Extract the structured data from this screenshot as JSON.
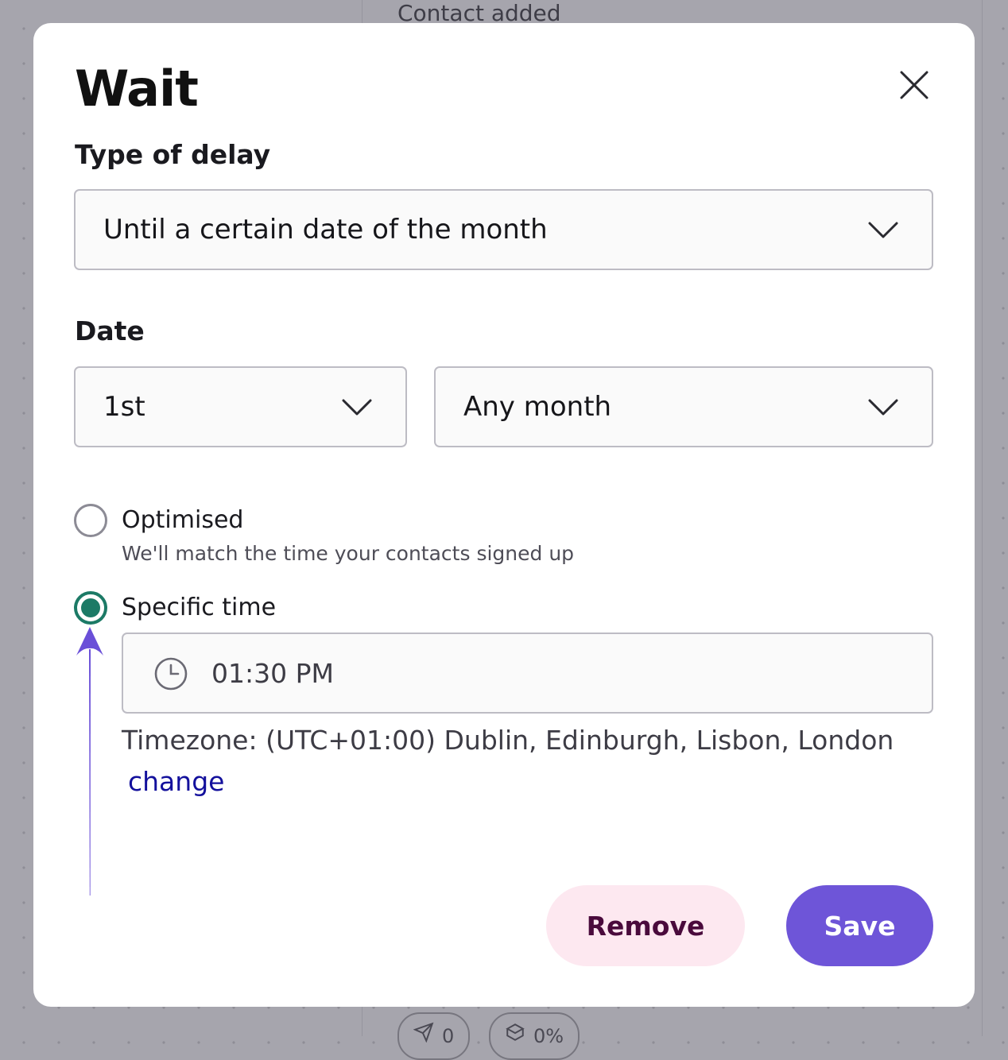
{
  "background": {
    "node_title": "Contact added",
    "pills": [
      {
        "icon": "send-icon",
        "value": "0"
      },
      {
        "icon": "open-box-icon",
        "value": "0%"
      }
    ]
  },
  "modal": {
    "title": "Wait",
    "close_icon": "close-icon",
    "type_of_delay": {
      "label": "Type of delay",
      "selected": "Until a certain date of the month"
    },
    "date": {
      "label": "Date",
      "day": "1st",
      "month": "Any month"
    },
    "timing": {
      "options": [
        {
          "label": "Optimised",
          "hint": "We'll match the time your contacts signed up",
          "checked": false
        },
        {
          "label": "Specific time",
          "checked": true
        }
      ],
      "time_value": "01:30 PM",
      "timezone": "Timezone: (UTC+01:00) Dublin, Edinburgh, Lisbon, London",
      "change_link": "change"
    },
    "buttons": {
      "remove": "Remove",
      "save": "Save"
    }
  },
  "colors": {
    "accent": "#6e55d8",
    "radio_checked": "#1c7a66",
    "link": "#13109c",
    "remove_bg": "#fde8f0",
    "annotation_arrow": "#6a4fd8"
  }
}
